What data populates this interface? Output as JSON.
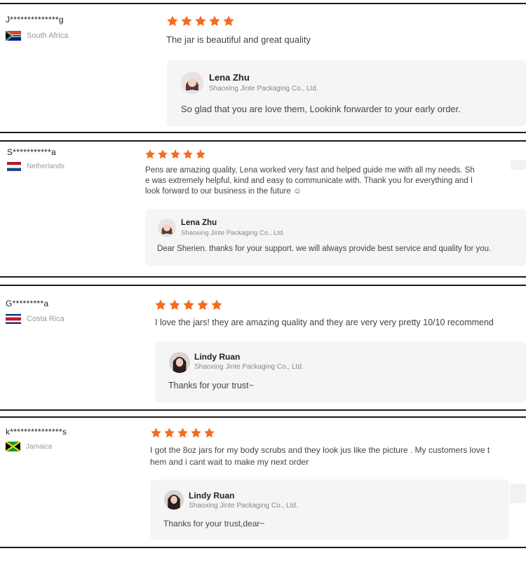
{
  "colors": {
    "star": "#f56b1f",
    "reply_bg": "#f5f5f5",
    "divider": "#1a1a1a"
  },
  "reviews": [
    {
      "buyer": "J**************g",
      "country": "South Africa",
      "rating": 5,
      "comment": "The jar is beautiful and great quality",
      "reply": {
        "name": "Lena Zhu",
        "company": "Shaoxing Jinte Packaging Co., Ltd.",
        "text": "So glad that you are love them, Lookink forwarder to your early order."
      }
    },
    {
      "buyer": "S***********a",
      "country": "Netherlands",
      "rating": 5,
      "comment_lines": [
        "Pens are amazing quality, Lena worked very fast and helped guide me with all my needs. Sh",
        "e was extremely helpful, kind and easy to communicate with. Thank you for everything and I",
        "look forward to our business in the future ☺"
      ],
      "reply": {
        "name": "Lena Zhu",
        "company": "Shaoxing Jinte Packaging Co., Ltd.",
        "text": "Dear Sherien. thanks for your support. we will always provide best service and quality for you."
      }
    },
    {
      "buyer": "G*********a",
      "country": "Costa Rica",
      "rating": 5,
      "comment": "I love the jars! they are amazing quality and they are very very pretty 10/10 recommend",
      "reply": {
        "name": "Lindy Ruan",
        "company": "Shaoxing Jinte Packaging Co., Ltd.",
        "text": "Thanks for your trust~"
      }
    },
    {
      "buyer": "k***************s",
      "country": "Jamaica",
      "rating": 5,
      "comment_lines": [
        "I got the 8oz jars for my body scrubs and they look jus like the picture . My customers love t",
        "hem and i cant wait to make my next order"
      ],
      "reply": {
        "name": "Lindy Ruan",
        "company": "Shaoxing Jinte Packaging Co., Ltd.",
        "text": "Thanks for your trust,dear~"
      }
    }
  ]
}
